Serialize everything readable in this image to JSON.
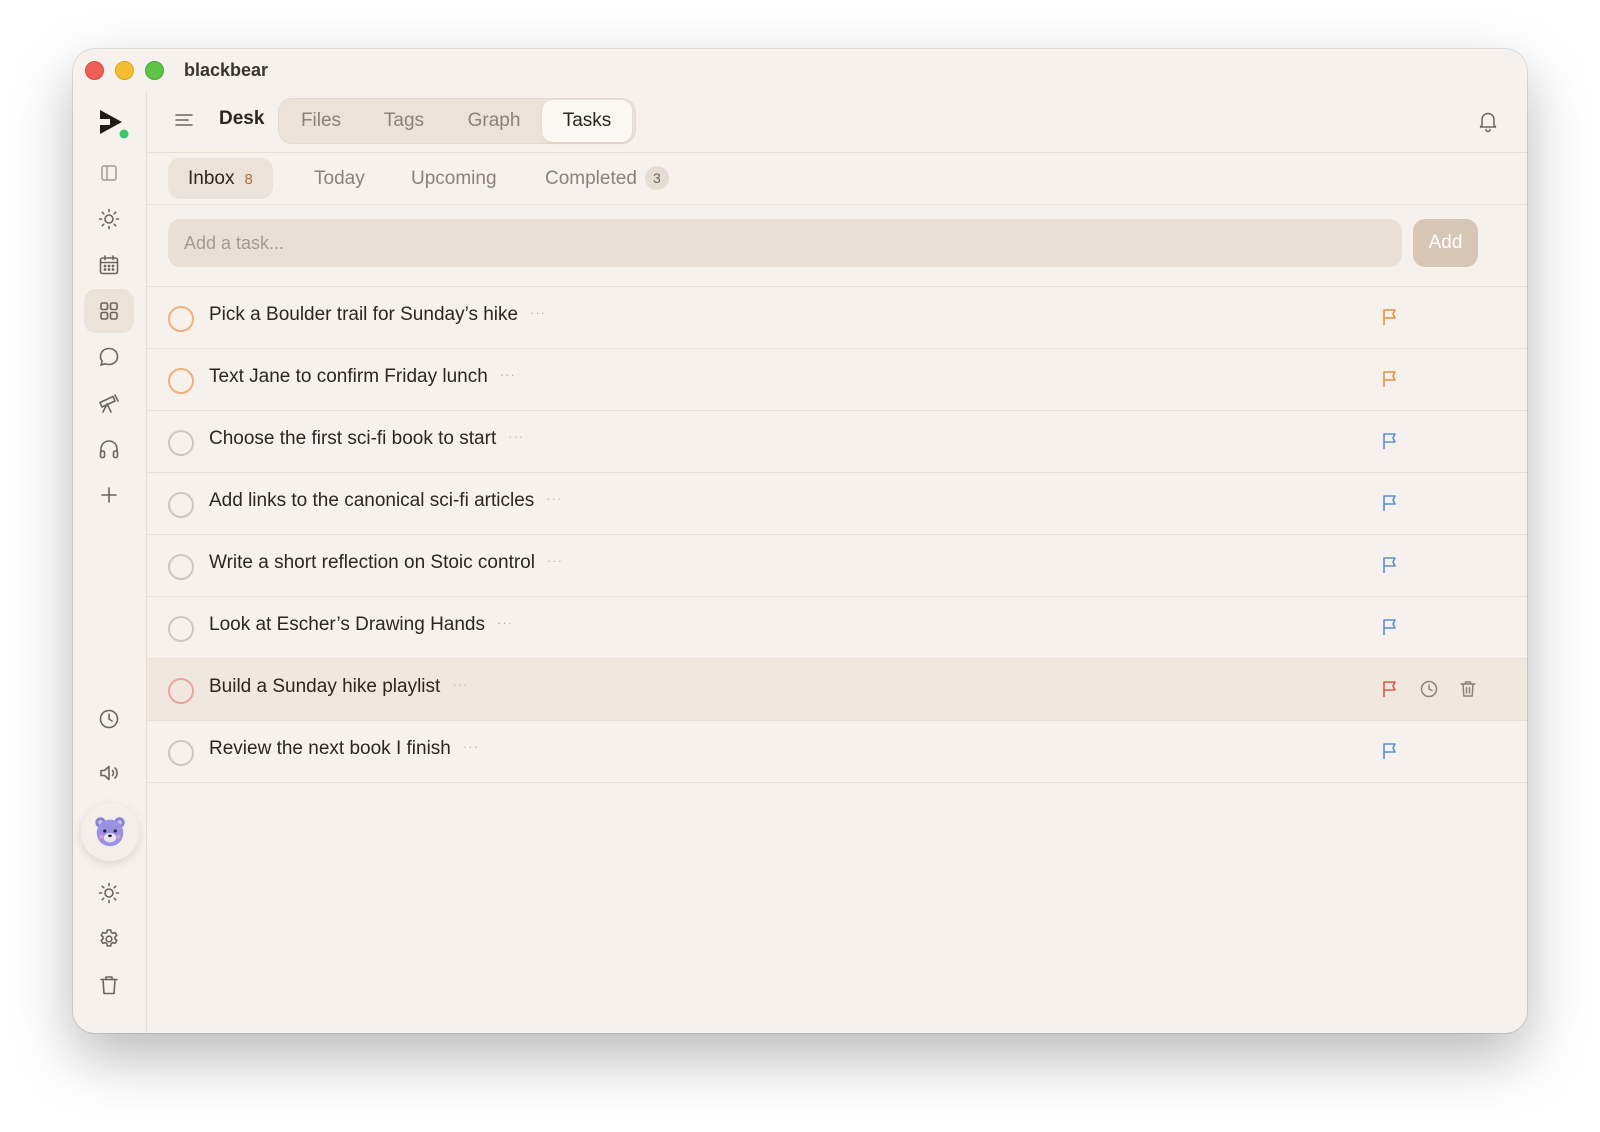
{
  "app": {
    "title": "blackbear"
  },
  "nav": {
    "desk_label": "Desk",
    "tabs": [
      {
        "label": "Files"
      },
      {
        "label": "Tags"
      },
      {
        "label": "Graph"
      },
      {
        "label": "Tasks"
      }
    ],
    "active_tab": "Tasks"
  },
  "subtabs": {
    "inbox": {
      "label": "Inbox",
      "count": "8"
    },
    "today": {
      "label": "Today"
    },
    "upcoming": {
      "label": "Upcoming"
    },
    "completed": {
      "label": "Completed",
      "count": "3"
    },
    "active": "Inbox"
  },
  "add_task": {
    "placeholder": "Add a task...",
    "value": "",
    "button_label": "Add"
  },
  "tasks": [
    {
      "title": "Pick a Boulder trail for Sunday’s hike",
      "more": "···",
      "priority_color": "#e8903a"
    },
    {
      "title": "Text Jane to confirm Friday lunch",
      "more": "···",
      "priority_color": "#e8903a"
    },
    {
      "title": "Choose the first sci-fi book to start",
      "more": "···",
      "priority_color": "#5b8fd6"
    },
    {
      "title": "Add links to the canonical sci-fi articles",
      "more": "···",
      "priority_color": "#5b8fd6"
    },
    {
      "title": "Write a short reflection on Stoic control",
      "more": "···",
      "priority_color": "#5b8fd6"
    },
    {
      "title": "Look at Escher’s Drawing Hands",
      "more": "···",
      "priority_color": "#5b8fd6"
    },
    {
      "title": "Build a Sunday hike playlist",
      "more": "···",
      "priority_color": "#e2574c",
      "hovered": true
    },
    {
      "title": "Review the next book I finish",
      "more": "···",
      "priority_color": "#5b8fd6"
    }
  ],
  "sidebar": {
    "top_icons": [
      "logo-icon",
      "sidebar-toggle-icon",
      "sun-icon",
      "calendar-icon",
      "grid-icon",
      "chat-icon",
      "telescope-icon",
      "headphones-icon",
      "plus-icon"
    ],
    "active_icon": "grid-icon",
    "bottom_icons": [
      "clock-icon",
      "speaker-icon",
      "bear-avatar",
      "sun-icon",
      "gear-icon",
      "trash-icon"
    ]
  },
  "colors": {
    "background": "#f6f1ec",
    "accent": "#d8c6b5",
    "flag_orange": "#e8903a",
    "flag_blue": "#5b8fd6",
    "flag_red": "#e2574c"
  }
}
